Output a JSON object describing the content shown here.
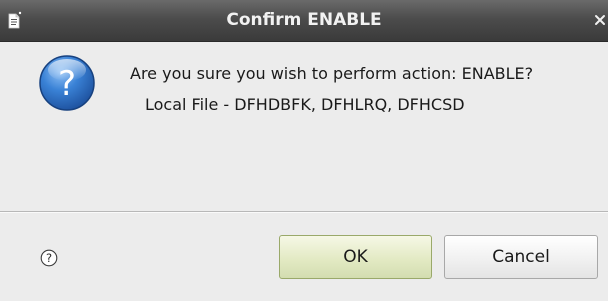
{
  "window": {
    "title": "Confirm ENABLE",
    "app_icon": "document-icon",
    "close_icon": "close-icon"
  },
  "dialog": {
    "icon": "question-icon",
    "message": "Are you sure you wish to perform action: ENABLE?",
    "detail": "Local File - DFHDBFK, DFHLRQ, DFHCSD"
  },
  "footer": {
    "help_icon": "help-icon",
    "ok_label": "OK",
    "cancel_label": "Cancel"
  },
  "colors": {
    "titlebar": "#4c4c4c",
    "background": "#ececec",
    "question_icon": "#2f6fc0",
    "ok_button": "#e3eac4"
  }
}
